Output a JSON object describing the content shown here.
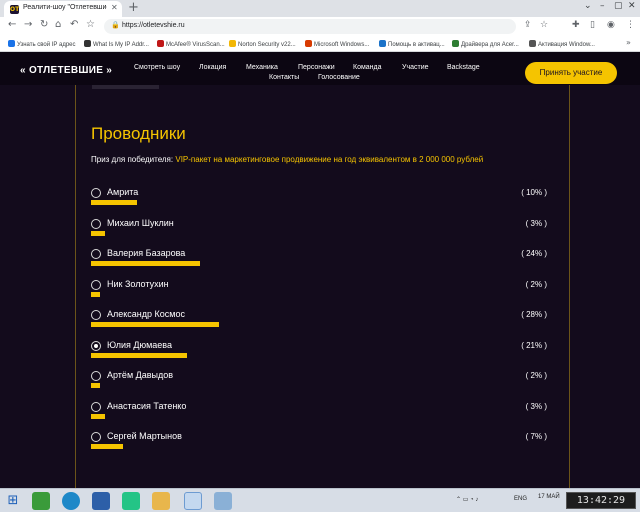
{
  "browser": {
    "tab_title": "Реалити-шоу \"Отлетевшие\". Тр",
    "tab_favicon_text": "OT",
    "url": "https://otletevshie.ru",
    "bookmarks": [
      {
        "label": "Узнать свой IP адрес",
        "color": "#1a73e8"
      },
      {
        "label": "What Is My IP Addr...",
        "color": "#333333"
      },
      {
        "label": "McAfee® VirusScan...",
        "color": "#c01818"
      },
      {
        "label": "Norton Security v22...",
        "color": "#f2b705"
      },
      {
        "label": "Microsoft Windows...",
        "color": "#d83b01"
      },
      {
        "label": "Помощь в активац...",
        "color": "#1b73c9"
      },
      {
        "label": "Драйвера для Acer...",
        "color": "#2e7d32"
      },
      {
        "label": "Активация Window...",
        "color": "#555555"
      }
    ]
  },
  "site": {
    "logo": "« ОТЛЕТЕВШИЕ »",
    "nav": [
      "Смотреть шоу",
      "Локация",
      "Механика",
      "Персонажи",
      "Команда",
      "Участие",
      "Backstage",
      "Контакты",
      "Голосование"
    ],
    "cta": "Принять участие"
  },
  "poll": {
    "title": "Проводники",
    "prize_label": "Приз для победителя:",
    "prize_value": "VIP-пакет на маркетинговое продвижение на год эквивалентом в 2 000 000 рублей",
    "options": [
      {
        "name": "Амрита",
        "percent_text": "( 10% )",
        "percent": 10,
        "selected": false
      },
      {
        "name": "Михаил Шуклин",
        "percent_text": "( 3% )",
        "percent": 3,
        "selected": false
      },
      {
        "name": "Валерия Базарова",
        "percent_text": "( 24% )",
        "percent": 24,
        "selected": false
      },
      {
        "name": "Ник Золотухин",
        "percent_text": "( 2% )",
        "percent": 2,
        "selected": false
      },
      {
        "name": "Александр Космос",
        "percent_text": "( 28% )",
        "percent": 28,
        "selected": false
      },
      {
        "name": "Юлия Дюмаева",
        "percent_text": "( 21% )",
        "percent": 21,
        "selected": true
      },
      {
        "name": "Артём Давыдов",
        "percent_text": "( 2% )",
        "percent": 2,
        "selected": false
      },
      {
        "name": "Анастасия Татенко",
        "percent_text": "( 3% )",
        "percent": 3,
        "selected": false
      },
      {
        "name": "Сергей Мартынов",
        "percent_text": "( 7% )",
        "percent": 7,
        "selected": false
      }
    ]
  },
  "taskbar": {
    "lang": "ENG",
    "date_short": "17 МАЙ",
    "clock": "13:42:29"
  },
  "colors": {
    "accent": "#f5c400",
    "page_bg": "#130b1c"
  }
}
